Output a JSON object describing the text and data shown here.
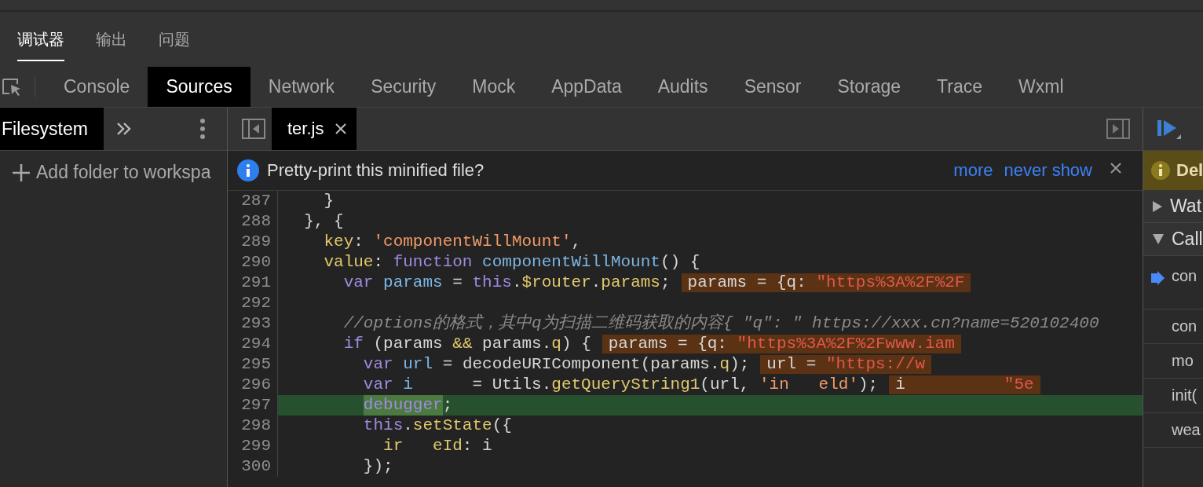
{
  "top_tabs": [
    {
      "label": "调试器",
      "selected": true
    },
    {
      "label": "输出",
      "selected": false
    },
    {
      "label": "问题",
      "selected": false
    }
  ],
  "panel_tabs": [
    {
      "label": "Console",
      "selected": false
    },
    {
      "label": "Sources",
      "selected": true
    },
    {
      "label": "Network",
      "selected": false
    },
    {
      "label": "Security",
      "selected": false
    },
    {
      "label": "Mock",
      "selected": false
    },
    {
      "label": "AppData",
      "selected": false
    },
    {
      "label": "Audits",
      "selected": false
    },
    {
      "label": "Sensor",
      "selected": false
    },
    {
      "label": "Storage",
      "selected": false
    },
    {
      "label": "Trace",
      "selected": false
    },
    {
      "label": "Wxml",
      "selected": false
    }
  ],
  "navigator": {
    "tabs": [
      {
        "label": "Filesystem",
        "selected": true
      }
    ],
    "add_folder": "Add folder to workspa"
  },
  "editor": {
    "file_tabs": [
      {
        "label": "ter.js",
        "selected": true
      }
    ],
    "infobar": {
      "message": "Pretty-print this minified file?",
      "links": [
        "more",
        "never show"
      ]
    },
    "lines": [
      {
        "number": "287",
        "paused": false,
        "tokens": [
          {
            "text": "    }",
            "kind": "plain"
          }
        ]
      },
      {
        "number": "288",
        "paused": false,
        "tokens": [
          {
            "text": "  }, {",
            "kind": "plain"
          }
        ]
      },
      {
        "number": "289",
        "paused": false,
        "tokens": [
          {
            "text": "    key",
            "kind": "prop"
          },
          {
            "text": ": ",
            "kind": "plain"
          },
          {
            "text": "'componentWillMount'",
            "kind": "string"
          },
          {
            "text": ",",
            "kind": "plain"
          }
        ]
      },
      {
        "number": "290",
        "paused": false,
        "tokens": [
          {
            "text": "    value",
            "kind": "prop"
          },
          {
            "text": ": ",
            "kind": "plain"
          },
          {
            "text": "function",
            "kind": "keyword"
          },
          {
            "text": " componentWillMount",
            "kind": "ident"
          },
          {
            "text": "() {",
            "kind": "plain"
          }
        ]
      },
      {
        "number": "291",
        "paused": false,
        "tokens": [
          {
            "text": "      var",
            "kind": "keyword"
          },
          {
            "text": " params",
            "kind": "ident"
          },
          {
            "text": " = ",
            "kind": "plain"
          },
          {
            "text": "this",
            "kind": "keyword"
          },
          {
            "text": ".",
            "kind": "plain"
          },
          {
            "text": "$router",
            "kind": "prop"
          },
          {
            "text": ".",
            "kind": "plain"
          },
          {
            "text": "params",
            "kind": "prop"
          },
          {
            "text": ";",
            "kind": "plain"
          }
        ],
        "inline_value": [
          {
            "text": "params = {q: ",
            "kind": "plain"
          },
          {
            "text": "\"https%3A%2F%2F",
            "kind": "value_string"
          }
        ]
      },
      {
        "number": "292",
        "paused": false
      },
      {
        "number": "293",
        "paused": false,
        "tokens": [
          {
            "text": "      //options的格式，其中q为扫描二维码获取的内容{ \"q\": \" https://xxx.cn?name=520102400",
            "kind": "comment"
          }
        ]
      },
      {
        "number": "294",
        "paused": false,
        "tokens": [
          {
            "text": "      if",
            "kind": "keyword"
          },
          {
            "text": " (params ",
            "kind": "plain"
          },
          {
            "text": "&&",
            "kind": "prop"
          },
          {
            "text": " params.",
            "kind": "plain"
          },
          {
            "text": "q",
            "kind": "prop"
          },
          {
            "text": ") {",
            "kind": "plain"
          }
        ],
        "inline_value": [
          {
            "text": "params = {q: ",
            "kind": "plain"
          },
          {
            "text": "\"https%3A%2F%2Fwww.iam",
            "kind": "value_string"
          }
        ]
      },
      {
        "number": "295",
        "paused": false,
        "tokens": [
          {
            "text": "        var",
            "kind": "keyword"
          },
          {
            "text": " url",
            "kind": "ident"
          },
          {
            "text": " = decodeURIComponent(params.",
            "kind": "plain"
          },
          {
            "text": "q",
            "kind": "prop"
          },
          {
            "text": ");",
            "kind": "plain"
          }
        ],
        "inline_value": [
          {
            "text": "url = ",
            "kind": "plain"
          },
          {
            "text": "\"https://w",
            "kind": "value_string"
          }
        ]
      },
      {
        "number": "296",
        "paused": false,
        "tokens": [
          {
            "text": "        var",
            "kind": "keyword"
          },
          {
            "text": " i",
            "kind": "ident"
          },
          {
            "text": "      = Utils.",
            "kind": "plain"
          },
          {
            "text": "getQueryString1",
            "kind": "prop"
          },
          {
            "text": "(url, ",
            "kind": "plain"
          },
          {
            "text": "'in   eld'",
            "kind": "string"
          },
          {
            "text": ");",
            "kind": "plain"
          }
        ],
        "inline_value": [
          {
            "text": "i          ",
            "kind": "plain"
          },
          {
            "text": "\"5e",
            "kind": "value_string"
          }
        ]
      },
      {
        "number": "297",
        "paused": true,
        "tokens": [
          {
            "text": "        debugger",
            "kind": "keyword"
          },
          {
            "text": ";",
            "kind": "plain"
          }
        ]
      },
      {
        "number": "298",
        "paused": false,
        "tokens": [
          {
            "text": "        this",
            "kind": "keyword"
          },
          {
            "text": ".",
            "kind": "plain"
          },
          {
            "text": "setState",
            "kind": "prop"
          },
          {
            "text": "({",
            "kind": "plain"
          }
        ]
      },
      {
        "number": "299",
        "paused": false,
        "tokens": [
          {
            "text": "          ir   eId",
            "kind": "prop"
          },
          {
            "text": ": i",
            "kind": "plain"
          }
        ]
      },
      {
        "number": "300",
        "paused": false,
        "tokens": [
          {
            "text": "        });",
            "kind": "plain"
          }
        ]
      }
    ]
  },
  "debugger": {
    "banner": "Del",
    "sections": [
      {
        "label": "Wat",
        "expanded": false
      },
      {
        "label": "Call",
        "expanded": true
      }
    ],
    "call_frames": [
      {
        "label": "con",
        "selected": true
      },
      {
        "label": "con",
        "selected": false
      },
      {
        "label": "mo",
        "selected": false
      },
      {
        "label": "init(",
        "selected": false
      },
      {
        "label": "wea",
        "selected": false
      }
    ]
  }
}
